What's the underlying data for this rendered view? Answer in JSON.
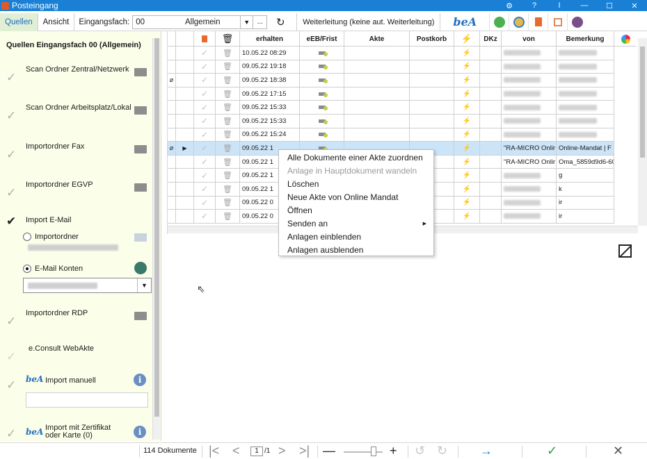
{
  "window": {
    "title": "Posteingang"
  },
  "toolbar": {
    "tab_sources": "Quellen",
    "tab_view": "Ansicht",
    "inbox_label": "Eingangsfach:",
    "inbox_code": "00",
    "inbox_name": "Allgemein",
    "more_button": "...",
    "forwarding": "Weiterleitung  (keine aut. Weiterleitung)",
    "bea_logo": "beA"
  },
  "sidebar": {
    "heading": "Quellen Eingangsfach 00 (Allgemein)",
    "items": [
      {
        "label": "Scan Ordner Zentral/Netzwerk"
      },
      {
        "label": "Scan Ordner Arbeitsplatz/Lokal"
      },
      {
        "label": "Importordner Fax"
      },
      {
        "label": "Importordner EGVP"
      },
      {
        "label": "Import E-Mail"
      },
      {
        "label": "Importordner RDP"
      },
      {
        "label": "e.Consult WebAkte"
      },
      {
        "label": "Import manuell"
      },
      {
        "label": "Import mit Zertifikat oder Karte (0)"
      }
    ],
    "radio_import_folder": "Importordner",
    "radio_email_accounts": "E-Mail Konten",
    "bea_label": "beA"
  },
  "grid": {
    "columns": [
      "",
      "",
      "",
      "erhalten",
      "eEB/Frist",
      "Akte",
      "Postkorb",
      "",
      "DKz",
      "von",
      "Bemerkung",
      ""
    ],
    "rows": [
      {
        "received": "10.05.22 08:29",
        "von": "",
        "bemerkung": ""
      },
      {
        "received": "09.05.22 19:18",
        "von": "",
        "bemerkung": ""
      },
      {
        "received": "09.05.22 18:38",
        "von": "",
        "bemerkung": ""
      },
      {
        "received": "09.05.22 17:15",
        "von": "",
        "bemerkung": ""
      },
      {
        "received": "09.05.22 15:33",
        "von": "",
        "bemerkung": ""
      },
      {
        "received": "09.05.22 15:33",
        "von": "",
        "bemerkung": ""
      },
      {
        "received": "09.05.22 15:24",
        "von": "",
        "bemerkung": ""
      },
      {
        "received": "09.05.22 1",
        "von": "\"RA-MICRO Onlir",
        "bemerkung": "Online-Mandat | F"
      },
      {
        "received": "09.05.22 1",
        "von": "\"RA-MICRO Onlir",
        "bemerkung": "Oma_5859d9d6-60"
      },
      {
        "received": "09.05.22 1",
        "von": "",
        "bemerkung": "g"
      },
      {
        "received": "09.05.22 1",
        "von": "",
        "bemerkung": "k"
      },
      {
        "received": "09.05.22 0",
        "von": "",
        "bemerkung": "ir"
      },
      {
        "received": "09.05.22 0",
        "von": "",
        "bemerkung": "ir"
      }
    ]
  },
  "context_menu": {
    "items": [
      {
        "label": "Alle Dokumente einer Akte zuordnen"
      },
      {
        "label": "Anlage in Hauptdokument wandeln"
      },
      {
        "label": "Löschen"
      },
      {
        "label": "Neue Akte von Online Mandat"
      },
      {
        "label": "Öffnen"
      },
      {
        "label": "Senden an"
      },
      {
        "label": "Anlagen einblenden"
      },
      {
        "label": "Anlagen ausblenden"
      }
    ]
  },
  "statusbar": {
    "document_count": "114  Dokumente",
    "page_current": "1",
    "page_total": "/1"
  },
  "colors": {
    "titlebar": "#1a80d6",
    "sidebar_bg": "#fbfee9",
    "selected_row": "#cce4f7",
    "confirm_green": "#2e9e4a",
    "forward_blue": "#1a80d6"
  }
}
